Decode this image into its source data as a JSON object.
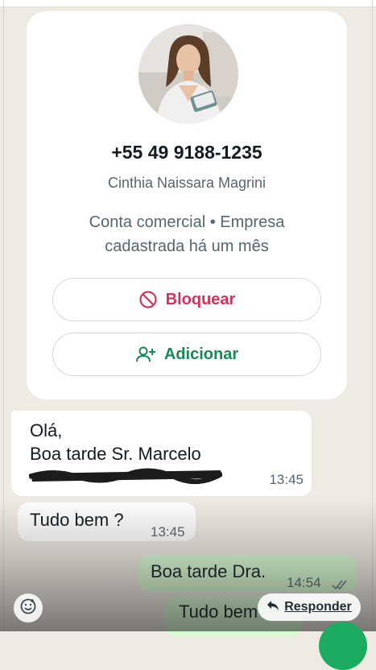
{
  "contact": {
    "phone": "+55 49 9188-1235",
    "name": "Cinthia Naissara Magrini",
    "business_line1": "Conta comercial • Empresa",
    "business_line2": "cadastrada há um mês",
    "block_label": "Bloquear",
    "add_label": "Adicionar"
  },
  "messages": [
    {
      "line1": "Olá,",
      "line2": "Boa tarde Sr. Marcelo",
      "time": "13:45"
    },
    {
      "text": "Tudo bem ?",
      "time": "13:45"
    },
    {
      "text": "Boa tarde Dra.",
      "time": "14:54"
    },
    {
      "text": "Tudo bem"
    }
  ],
  "reply_label": "Responder",
  "colors": {
    "chat_background": "#efeae2",
    "outgoing_bubble": "#d9fdd3",
    "block_red": "#d1335b",
    "add_green": "#1b8755"
  }
}
